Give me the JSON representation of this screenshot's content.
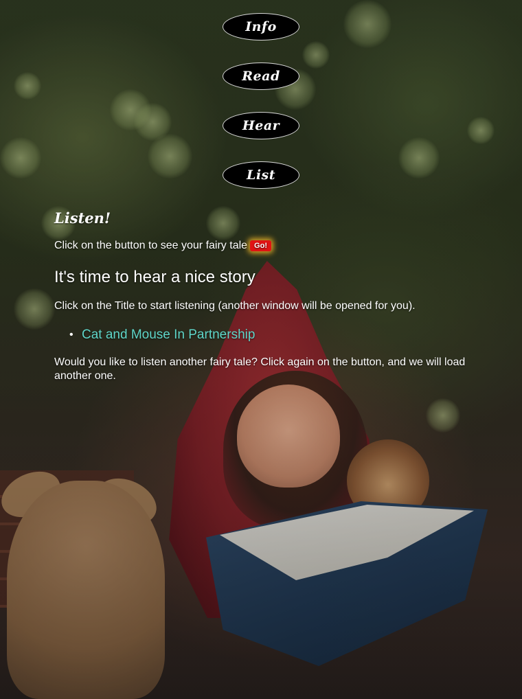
{
  "nav": {
    "items": [
      {
        "label": "Info"
      },
      {
        "label": "Read"
      },
      {
        "label": "Hear"
      },
      {
        "label": "List"
      }
    ]
  },
  "listen": {
    "title": "Listen!",
    "instruction_text": "Click on the button to see your fairy tale",
    "go_button_label": "Go!",
    "heading": "It's time to hear a nice story",
    "click_title_text": "Click on the Title to start listening (another window will be opened for you).",
    "stories": [
      {
        "title": "Cat and Mouse In Partnership"
      }
    ],
    "again_text": "Would you like to listen another fairy tale? Click again on the button, and we will load another one."
  },
  "colors": {
    "nav_button_bg": "#000000",
    "go_button_bg": "#e01414",
    "link_color": "#5fd6c9"
  }
}
